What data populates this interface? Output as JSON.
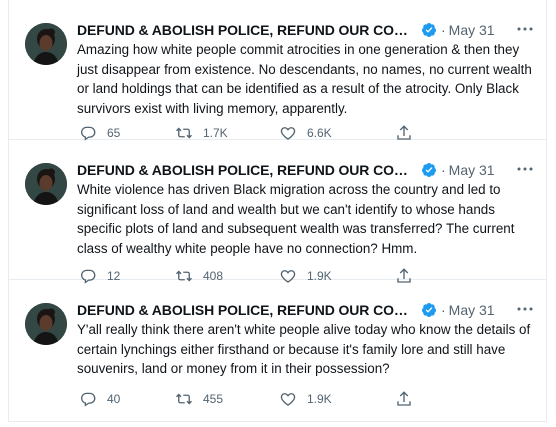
{
  "colors": {
    "verified": "#1d9bf0",
    "secondary_text": "#536471",
    "primary_text": "#0f1419",
    "divider": "#e6ecf0"
  },
  "icons": {
    "reply": "speech-bubble",
    "retweet": "retweet-arrows",
    "like": "heart",
    "share": "share-upload",
    "verified": "verified-badge",
    "more": "more-dots"
  },
  "tweets": [
    {
      "author": "DEFUND & ABOLISH POLICE, REFUND OUR COMMU...",
      "separator": "·",
      "date": "May 31",
      "text": "Amazing how white people commit atrocities in one generation & then they just disappear from existence. No descendants, no names, no current wealth or land holdings that can be identified as a result of the atrocity. Only Black survivors exist with living memory, apparently.",
      "replies": "65",
      "retweets": "1.7K",
      "likes": "6.6K"
    },
    {
      "author": "DEFUND & ABOLISH POLICE, REFUND OUR COMMU...",
      "separator": "·",
      "date": "May 31",
      "text": "White violence has driven Black migration across the country and led to significant loss of land and wealth but we can't identify to whose hands specific plots of land and subsequent wealth was transferred? The current class of wealthy white people have no connection? Hmm.",
      "replies": "12",
      "retweets": "408",
      "likes": "1.9K"
    },
    {
      "author": "DEFUND & ABOLISH POLICE, REFUND OUR COMMU...",
      "separator": "·",
      "date": "May 31",
      "text": "Y'all really think there aren't white people alive today who know the details of certain lynchings either firsthand or because it's family lore and still have souvenirs, land or money from it in their possession?",
      "replies": "40",
      "retweets": "455",
      "likes": "1.9K"
    }
  ]
}
